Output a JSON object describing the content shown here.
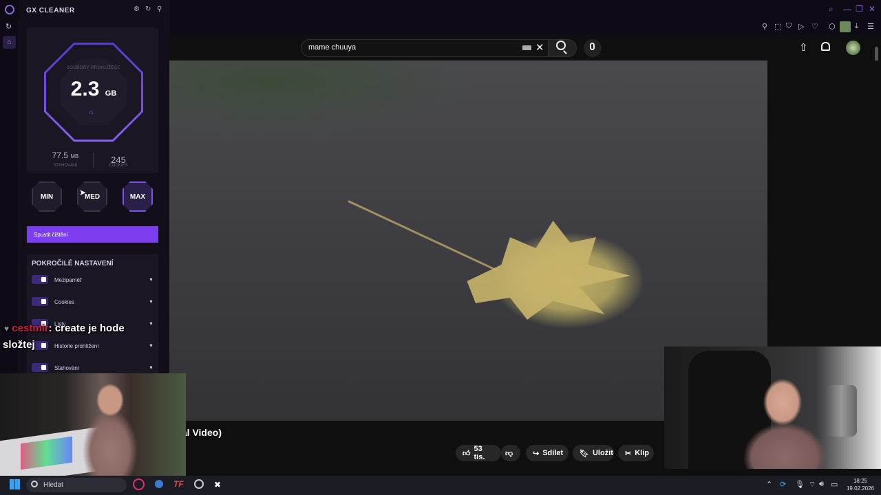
{
  "browser": {
    "window_controls": [
      "search",
      "minimize",
      "restore",
      "close"
    ]
  },
  "gx_cleaner": {
    "title": "GX CLEANER",
    "files_label": "SOUBORY PROHLÍŽEČE",
    "size_value": "2.3",
    "size_unit": "GB",
    "downloads_value": "77.5",
    "downloads_unit": "MB",
    "downloads_label": "STAHOVÁNÍ",
    "cookies_value": "245",
    "cookies_label": "COOKIES",
    "modes": [
      "MIN",
      "MED",
      "MAX"
    ],
    "run_button": "Spustit čištění",
    "advanced_title": "POKROČILÉ NASTAVENÍ",
    "options": [
      "Mezipaměť",
      "Cookies",
      "Listy",
      "Historie prohlížení",
      "Stahování"
    ]
  },
  "youtube": {
    "search_value": "mame chuuya",
    "title_fragment": "ial Video)",
    "actions": {
      "likes": "53 tis.",
      "share": "Sdílet",
      "save": "Uložit",
      "clip": "Klip"
    }
  },
  "chat": {
    "username": "cestmir",
    "message": ": create je hode",
    "message_line2": "složtej"
  },
  "taskbar": {
    "search_placeholder": "Hledat",
    "time": "18:25",
    "date": "19.02.2026"
  },
  "colors": {
    "accent": "#7a3ef0",
    "gx_bg": "#120f1a",
    "yt_bg": "#0f0f0f"
  }
}
